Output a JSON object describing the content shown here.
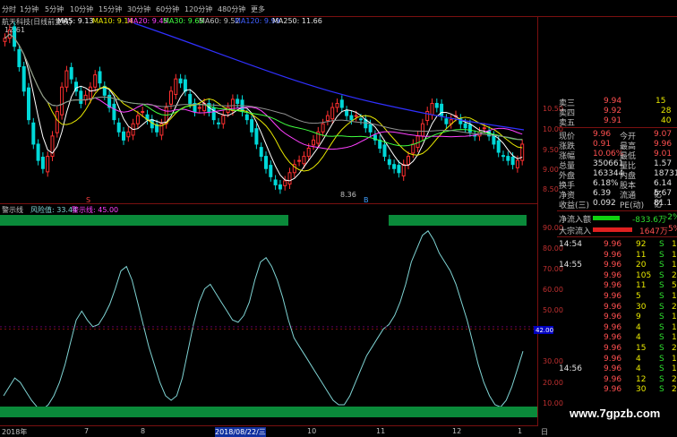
{
  "toolbar": {
    "periods": [
      "分时",
      "1分钟",
      "5分钟",
      "10分钟",
      "15分钟",
      "30分钟",
      "60分钟",
      "120分钟",
      "480分钟",
      "更多"
    ]
  },
  "main_indicator": {
    "stock_name": "航天科技(日线前复权)",
    "ma5": "MA5: 9.13",
    "ma10": "MA10: 9.14",
    "ma20": "MA20: 9.45",
    "ma30": "MA30: 9.65",
    "ma60": "MA60: 9.52",
    "ma120": "MA120: 9.99",
    "ma250": "MA250: 11.66",
    "high_label": "12.61",
    "low_label": "8.36",
    "marker_1": "S",
    "marker_2": "B"
  },
  "price_axis": [
    "10.50",
    "10.00",
    "9.50",
    "9.00",
    "8.50"
  ],
  "sub_indicator": {
    "name": "警示线",
    "risk": "风险值: 33.44",
    "warn": "警示线: 45.00",
    "axis": [
      "90.00",
      "80.00",
      "70.00",
      "60.00",
      "50.00",
      "40.00",
      "30.00",
      "20.00",
      "10.00"
    ],
    "current_value": "42.00"
  },
  "timebar": {
    "labels": [
      "2018年",
      "7",
      "8",
      "2018/08/22/三",
      "10",
      "11",
      "12",
      "1",
      "日"
    ]
  },
  "quote_panel": {
    "asks": [
      {
        "label": "卖三",
        "price": "9.94",
        "vol": "15"
      },
      {
        "label": "卖四",
        "price": "9.92",
        "vol": "28"
      },
      {
        "label": "卖五",
        "price": "9.91",
        "vol": "40"
      }
    ],
    "stats": [
      {
        "k1": "现价",
        "v1": "9.96",
        "k2": "今开",
        "v2": "9.07"
      },
      {
        "k1": "涨跌",
        "v1": "0.91",
        "k2": "最高",
        "v2": "9.96"
      },
      {
        "k1": "涨幅",
        "v1": "10.06%",
        "k2": "最低",
        "v2": "9.01"
      },
      {
        "k1": "总量",
        "v1": "350661",
        "k2": "量比",
        "v2": "1.57"
      },
      {
        "k1": "外盘",
        "v1": "163344",
        "k2": "内盘",
        "v2": "187317"
      },
      {
        "k1": "换手",
        "v1": "6.18%",
        "k2": "股本",
        "v2": "6.14亿"
      },
      {
        "k1": "净资",
        "v1": "6.39",
        "k2": "流通",
        "v2": "5.67亿"
      },
      {
        "k1": "收益(三)",
        "v1": "0.092",
        "k2": "PE(动)",
        "v2": "81.1"
      }
    ],
    "flows": [
      {
        "label": "净流入额",
        "value": "-833.6万",
        "pct": "-2%"
      },
      {
        "label": "大宗流入",
        "value": "1647万",
        "pct": "5%"
      }
    ],
    "ticks": [
      {
        "time": "14:54",
        "price": "9.96",
        "vol": "92",
        "side": "S",
        "n": "1"
      },
      {
        "time": "",
        "price": "9.96",
        "vol": "11",
        "side": "S",
        "n": "1"
      },
      {
        "time": "14:55",
        "price": "9.96",
        "vol": "20",
        "side": "S",
        "n": "1"
      },
      {
        "time": "",
        "price": "9.96",
        "vol": "105",
        "side": "S",
        "n": "2"
      },
      {
        "time": "",
        "price": "9.96",
        "vol": "11",
        "side": "S",
        "n": "5"
      },
      {
        "time": "",
        "price": "9.96",
        "vol": "5",
        "side": "S",
        "n": "1"
      },
      {
        "time": "",
        "price": "9.96",
        "vol": "30",
        "side": "S",
        "n": "2"
      },
      {
        "time": "",
        "price": "9.96",
        "vol": "9",
        "side": "S",
        "n": "1"
      },
      {
        "time": "",
        "price": "9.96",
        "vol": "4",
        "side": "S",
        "n": "1"
      },
      {
        "time": "",
        "price": "9.96",
        "vol": "4",
        "side": "S",
        "n": "1"
      },
      {
        "time": "",
        "price": "9.96",
        "vol": "15",
        "side": "S",
        "n": "2"
      },
      {
        "time": "",
        "price": "9.96",
        "vol": "4",
        "side": "S",
        "n": "1"
      },
      {
        "time": "14:56",
        "price": "9.96",
        "vol": "4",
        "side": "S",
        "n": "1"
      },
      {
        "time": "",
        "price": "9.96",
        "vol": "12",
        "side": "S",
        "n": "2"
      },
      {
        "time": "",
        "price": "9.96",
        "vol": "30",
        "side": "S",
        "n": "2"
      }
    ]
  },
  "watermark": "www.7gpzb.com",
  "colors": {
    "up": "#ff3030",
    "down": "#00d8d8",
    "ma5": "#ffffff",
    "ma10": "#e8e800",
    "ma20": "#ff40ff",
    "ma30": "#40ff40",
    "ma60": "#808080",
    "ma120": "#3030ff",
    "risk_line": "#7fd4d4",
    "band": "#0a8a3a",
    "yellow_fill": "#f0f000"
  }
}
